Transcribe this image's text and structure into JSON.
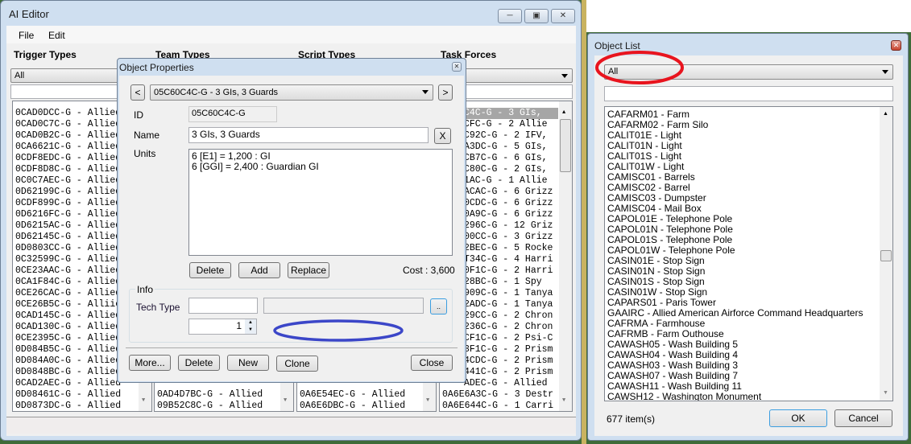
{
  "ai_editor": {
    "title": "AI Editor",
    "menu": [
      "File",
      "Edit"
    ],
    "columns": [
      {
        "header": "Trigger Types",
        "filter": "All",
        "items": [
          "0CAD0DCC-G - Allied",
          "0CAD0C7C-G - Allied",
          "0CAD0B2C-G - Allied",
          "0CA6621C-G - Allied",
          "0CDF8EDC-G - Allied",
          "0CDF8D8C-G - Allied",
          "0C0C7AEC-G - Allied",
          "0D62199C-G - Allied",
          "0CDF899C-G - Allied",
          "0D6216FC-G - Allied",
          "0D6215AC-G - Allied",
          "0D62145C-G - Allied",
          "0D0803CC-G - Allied",
          "0C32599C-G - Allied",
          "0CE23AAC-G - Allied",
          "0CA1F84C-G - Allied",
          "0CE26CAC-G - Allied",
          "0CE26B5C-G - Alliie",
          "0CAD145C-G - Allied",
          "0CAD130C-G - Allied",
          "0CE2395C-G - Allied",
          "0D084B5C-G - Allied",
          "0D084A0C-G - Allied",
          "0D0848BC-G - Allied",
          "0CAD2AEC-G - Allied",
          "0D08461C-G - Allied",
          "0D0873DC-G - Allied"
        ]
      },
      {
        "header": "Team Types",
        "items": [
          "0AD4D7BC-G - Allied",
          "09B52C8C-G - Allied"
        ]
      },
      {
        "header": "Script Types",
        "items": [
          "0A6E54EC-G - Allied",
          "0A6E6DBC-G - Allied"
        ]
      },
      {
        "header": "Task Forces",
        "items_partial": [
          "C4C-G - 3 GIs,",
          "CFC-G - 2 Allie",
          "C92C-G - 2 IFV,",
          "A3DC-G - 5 GIs,",
          "CB7C-G - 6 GIs,",
          "C80C-G - 2 GIs,",
          "1AC-G - 1 Allie",
          "ACAC-G - 6 Grizz",
          "0CDC-G - 6 Grizz",
          "0A9C-G - 6 Grizz",
          "296C-G - 12 Griz",
          "00CC-G - 3 Grizz",
          "2BEC-G - 5 Rocke",
          "T34C-G - 4 Harri",
          "0F1C-G - 2 Harri",
          "28BC-G - 1 Spy",
          "909C-G - 1 Tanya",
          "2ADC-G - 1 Tanya",
          "29CC-G - 2 Chron",
          "236C-G - 2 Chron",
          "CF1C-G - 2 Psi-C",
          "3F1C-G - 2 Prism",
          "4CDC-G - 2 Prism",
          "441C-G - 2 Prism",
          "ADEC-G - Allied"
        ],
        "items": [
          "0A6E6A3C-G - 3 Destr",
          "0A6E644C-G - 1 Carri"
        ]
      }
    ]
  },
  "object_properties": {
    "title": "Object Properties",
    "selector": "05C60C4C-G - 3 GIs, 3 Guards",
    "prev": "<",
    "next": ">",
    "id_label": "ID",
    "id_value": "05C60C4C-G",
    "name_label": "Name",
    "name_value": "3 GIs, 3 Guards",
    "clear": "X",
    "units_label": "Units",
    "units": [
      "6 [E1] = 1,200 : GI",
      "6 [GGI] = 2,400 : Guardian GI"
    ],
    "delete": "Delete",
    "add": "Add",
    "replace": "Replace",
    "cost": "Cost : 3,600",
    "info_label": "Info",
    "tech_type_label": "Tech Type",
    "tech_type_value": "",
    "browse": "..",
    "quantity": "1",
    "more": "More...",
    "delete2": "Delete",
    "new": "New",
    "clone": "Clone",
    "close": "Close"
  },
  "object_list": {
    "title": "Object List",
    "filter": "All",
    "search": "",
    "items": [
      "CAFARM01 - Farm",
      "CAFARM02 - Farm Silo",
      "CALIT01E - Light",
      "CALIT01N - Light",
      "CALIT01S - Light",
      "CALIT01W - Light",
      "CAMISC01 - Barrels",
      "CAMISC02 - Barrel",
      "CAMISC03 - Dumpster",
      "CAMISC04 - Mail Box",
      "CAPOL01E - Telephone Pole",
      "CAPOL01N - Telephone Pole",
      "CAPOL01S - Telephone Pole",
      "CAPOL01W - Telephone Pole",
      "CASIN01E - Stop Sign",
      "CASIN01N - Stop Sign",
      "CASIN01S - Stop Sign",
      "CASIN01W - Stop Sign",
      "CAPARS01 - Paris Tower",
      "GAAIRC - Allied American Airforce Command Headquarters",
      "CAFRMA - Farmhouse",
      "CAFRMB - Farm Outhouse",
      "CAWASH05 - Wash Building 5",
      "CAWASH04 - Wash Building 4",
      "CAWASH03 - Wash Building 3",
      "CAWASH07 - Wash Building 7",
      "CAWASH11 - Wash Building 11",
      "CAWSH12 - Washington Monument"
    ],
    "count": "677 item(s)",
    "ok": "OK",
    "cancel": "Cancel"
  },
  "colors": {
    "annotation_red": "#e8141e",
    "annotation_blue": "#3b46c8",
    "selection": "#a6a6a6"
  }
}
